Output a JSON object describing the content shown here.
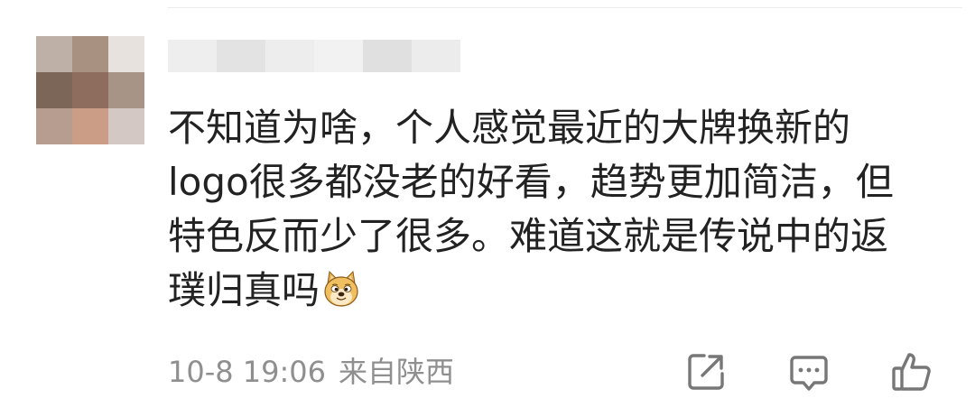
{
  "avatar": {
    "pixels": [
      "#bfb0a7",
      "#a99181",
      "#e8e2df",
      "#7c6658",
      "#8f6d5e",
      "#a89486",
      "#b69d90",
      "#cc9d86",
      "#d3c8c3"
    ]
  },
  "username": {
    "blocks": [
      "#eeeeee",
      "#e3e3e3",
      "#ededed",
      "#f2f2f2",
      "#e0e0e0",
      "#ececec"
    ]
  },
  "comment": {
    "lines": [
      "不知道为啥，个人感觉最近的大牌换新的",
      "logo很多都没老的好看，趋势更加简洁，但",
      "特色反而少了很多。难道这就是传说中的返",
      "璞归真吗"
    ],
    "emoji": "doge-emoji"
  },
  "footer": {
    "time": "10-8 19:06",
    "location": "来自陕西"
  },
  "actions": {
    "share_icon": "share-icon",
    "reply_icon": "comment-icon",
    "like_icon": "thumbs-up-icon",
    "icon_color": "#777777"
  }
}
